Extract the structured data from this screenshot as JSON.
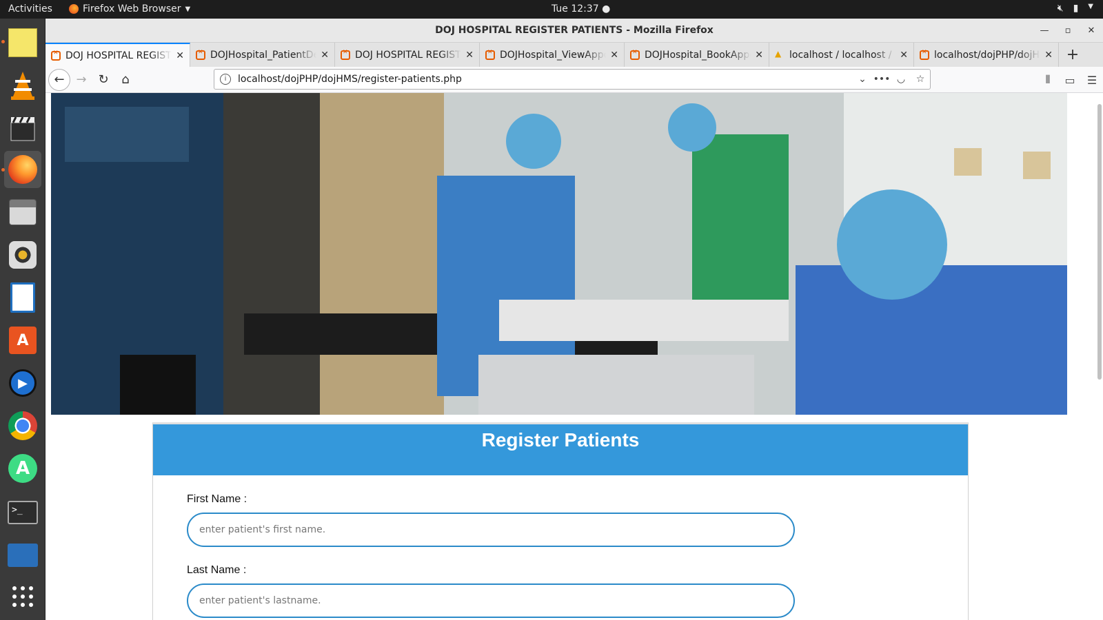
{
  "topbar": {
    "activities": "Activities",
    "app_menu": "Firefox Web Browser",
    "clock": "Tue 12:37"
  },
  "window": {
    "title": "DOJ HOSPITAL REGISTER PATIENTS - Mozilla Firefox"
  },
  "tabs": [
    {
      "label": "DOJ HOSPITAL REGISTER PATIENTS",
      "icon": "xampp-icon"
    },
    {
      "label": "DOJHospital_PatientDetails",
      "icon": "xampp-icon"
    },
    {
      "label": "DOJ HOSPITAL REGISTER PATIENTS",
      "icon": "xampp-icon"
    },
    {
      "label": "DOJHospital_ViewAppointments",
      "icon": "xampp-icon"
    },
    {
      "label": "DOJHospital_BookAppointment",
      "icon": "xampp-icon"
    },
    {
      "label": "localhost / localhost / hms",
      "icon": "phpmyadmin-icon"
    },
    {
      "label": "localhost/dojPHP/dojHMS",
      "icon": "xampp-icon"
    }
  ],
  "navbar": {
    "url": "localhost/dojPHP/dojHMS/register-patients.php"
  },
  "form": {
    "title": "Register Patients",
    "first_name_label": "First Name :",
    "first_name_placeholder": "enter patient's first name.",
    "last_name_label": "Last Name :",
    "last_name_placeholder": "enter patient's lastname."
  },
  "colors": {
    "header_blue": "#3498db",
    "input_border": "#2a8ac9",
    "tab_accent": "#0a84ff"
  }
}
